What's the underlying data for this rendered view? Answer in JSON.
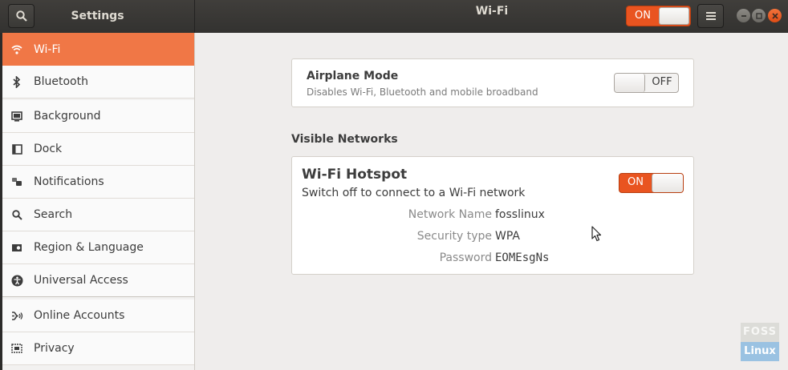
{
  "header": {
    "app_title": "Settings",
    "page_title": "Wi-Fi",
    "wifi_switch": "ON"
  },
  "sidebar": {
    "items": [
      {
        "label": "Wi-Fi",
        "icon": "wifi-icon",
        "active": true
      },
      {
        "label": "Bluetooth",
        "icon": "bluetooth-icon"
      },
      {
        "label": "Background",
        "icon": "background-icon"
      },
      {
        "label": "Dock",
        "icon": "dock-icon"
      },
      {
        "label": "Notifications",
        "icon": "notifications-icon"
      },
      {
        "label": "Search",
        "icon": "search-icon"
      },
      {
        "label": "Region & Language",
        "icon": "region-icon"
      },
      {
        "label": "Universal Access",
        "icon": "universal-access-icon"
      },
      {
        "label": "Online Accounts",
        "icon": "online-accounts-icon"
      },
      {
        "label": "Privacy",
        "icon": "privacy-icon"
      }
    ]
  },
  "airplane": {
    "title": "Airplane Mode",
    "description": "Disables Wi-Fi, Bluetooth and mobile broadband",
    "switch": "OFF"
  },
  "visible_networks": {
    "title": "Visible Networks"
  },
  "hotspot": {
    "title": "Wi-Fi Hotspot",
    "description": "Switch off to connect to a Wi-Fi network",
    "switch": "ON",
    "details": [
      {
        "label": "Network Name",
        "value": "fosslinux"
      },
      {
        "label": "Security type",
        "value": "WPA"
      },
      {
        "label": "Password",
        "value": "EOMEsgNs"
      }
    ]
  },
  "watermark": {
    "top": "FOSS",
    "bottom": "Linux"
  },
  "colors": {
    "accent": "#e95420",
    "active_item": "#f07746",
    "headerbar": "#3a3936"
  }
}
